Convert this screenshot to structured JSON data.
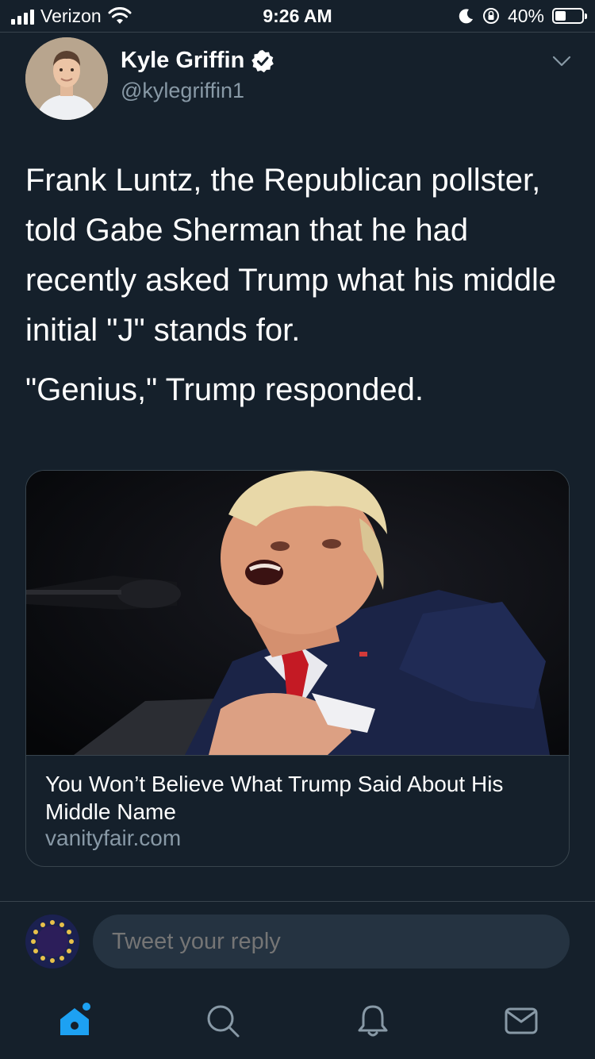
{
  "status_bar": {
    "carrier": "Verizon",
    "time": "9:26 AM",
    "battery_percent": "40%",
    "battery_level": 0.4,
    "icons": [
      "signal-bars-icon",
      "wifi-icon",
      "moon-icon",
      "rotation-lock-icon",
      "battery-icon"
    ]
  },
  "tweet": {
    "author_name": "Kyle Griffin",
    "author_handle": "@kylegriffin1",
    "verified": true,
    "text_paragraph_1": "Frank Luntz, the Republican pollster, told Gabe Sherman that he had recently asked Trump what his middle initial \"J\" stands for.",
    "text_paragraph_2": "\"Genius,\" Trump responded.",
    "link_card": {
      "title": "You Won’t Believe What Trump Said About His Middle Name",
      "domain": "vanityfair.com"
    }
  },
  "reply": {
    "placeholder": "Tweet your reply"
  },
  "tab_bar": {
    "tabs": [
      "home-icon",
      "search-icon",
      "notifications-icon",
      "messages-icon"
    ],
    "home_has_notification_dot": true
  },
  "colors": {
    "background": "#15202b",
    "accent": "#1da1f2",
    "secondary_text": "#8899a6",
    "border": "#38444d"
  }
}
